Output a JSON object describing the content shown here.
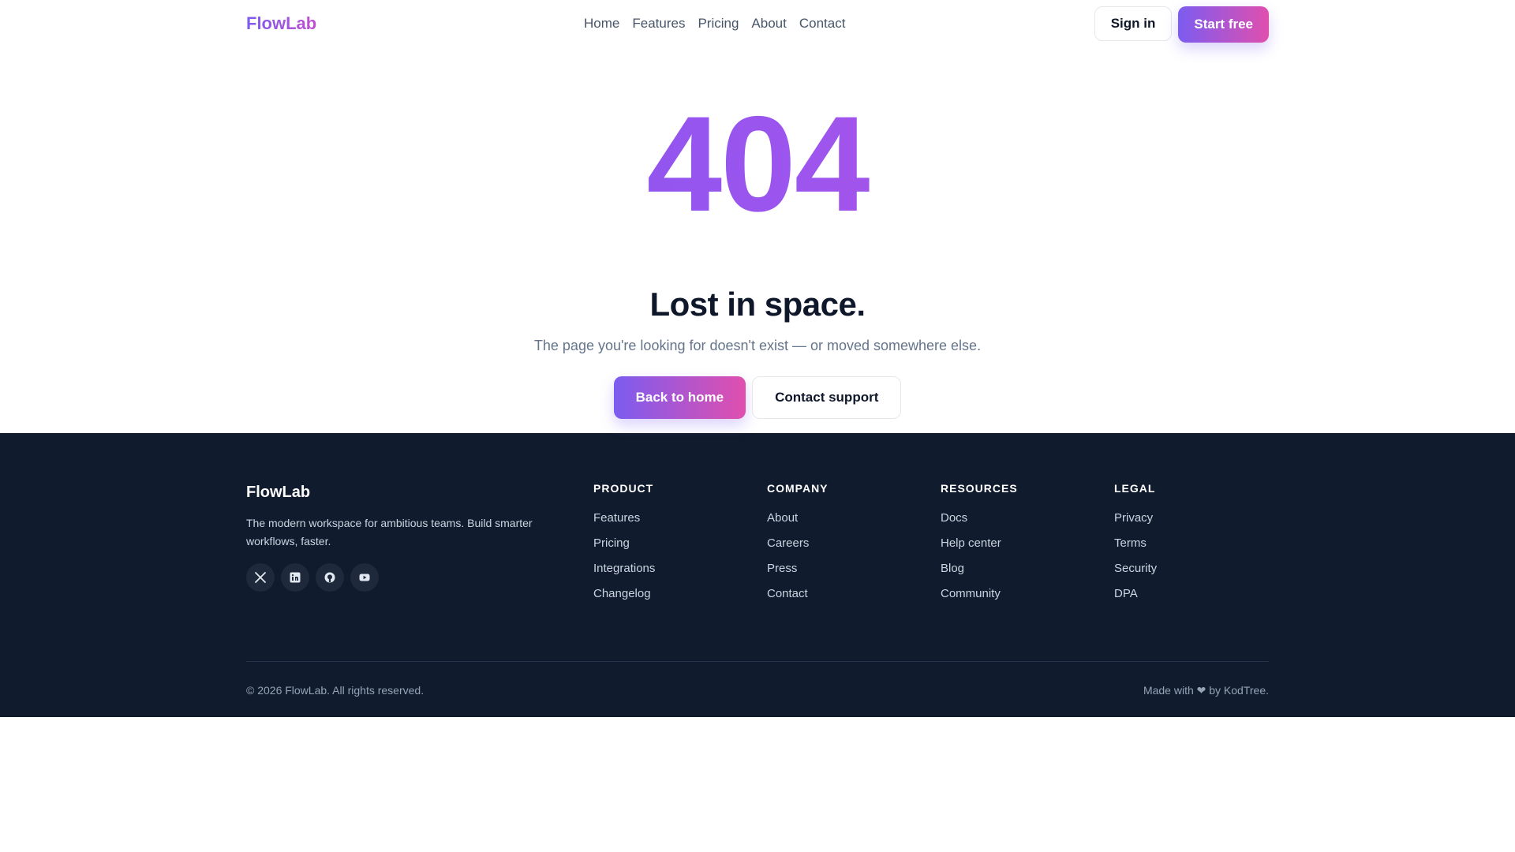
{
  "header": {
    "logo": "FlowLab",
    "nav": [
      "Home",
      "Features",
      "Pricing",
      "About",
      "Contact"
    ],
    "sign_in": "Sign in",
    "start_free": "Start free"
  },
  "hero": {
    "code": "404",
    "title": "Lost in space.",
    "subtitle": "The page you're looking for doesn't exist — or moved somewhere else.",
    "primary_cta": "Back to home",
    "secondary_cta": "Contact support"
  },
  "footer": {
    "brand": "FlowLab",
    "description": "The modern workspace for ambitious teams. Build smarter workflows, faster.",
    "socials": [
      "x-icon",
      "linkedin-icon",
      "github-icon",
      "youtube-icon"
    ],
    "columns": [
      {
        "title": "PRODUCT",
        "links": [
          "Features",
          "Pricing",
          "Integrations",
          "Changelog"
        ]
      },
      {
        "title": "COMPANY",
        "links": [
          "About",
          "Careers",
          "Press",
          "Contact"
        ]
      },
      {
        "title": "RESOURCES",
        "links": [
          "Docs",
          "Help center",
          "Blog",
          "Community"
        ]
      },
      {
        "title": "LEGAL",
        "links": [
          "Privacy",
          "Terms",
          "Security",
          "DPA"
        ]
      }
    ],
    "copyright": "© 2026 FlowLab. All rights reserved.",
    "made_with": "Made with ❤ by KodTree."
  },
  "colors": {
    "accent_start": "#7c5cf0",
    "accent_end": "#e04fae",
    "footer_bg": "#111b2e"
  }
}
